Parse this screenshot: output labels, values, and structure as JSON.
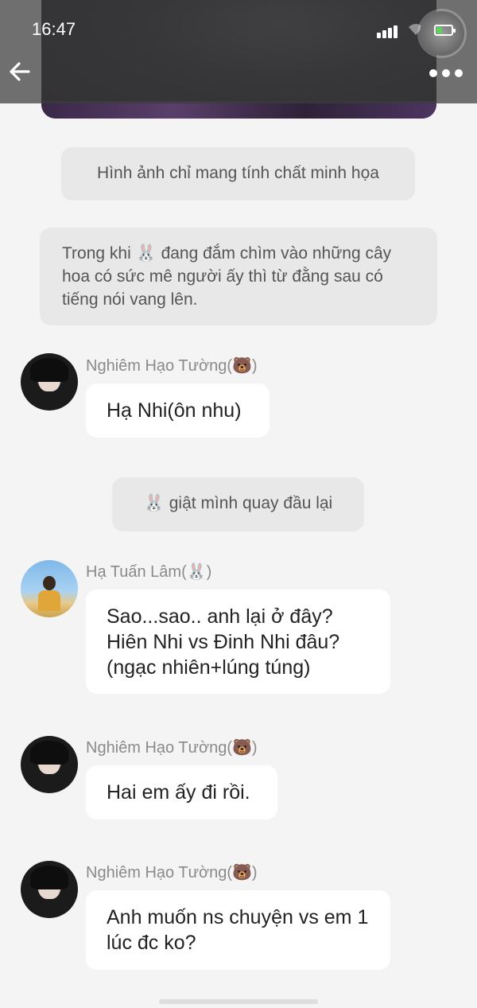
{
  "status_bar": {
    "time": "16:47"
  },
  "narrations": [
    "Hình ảnh chỉ mang tính chất minh họa",
    "Trong khi 🐰 đang đắm chìm vào những cây hoa có sức mê người ấy thì từ đằng sau có tiếng nói vang lên.",
    "🐰 giật mình quay đầu lại"
  ],
  "messages": [
    {
      "speaker": "Nghiêm Hạo Tường(🐻)",
      "text": "Hạ Nhi(ôn nhu)"
    },
    {
      "speaker": "Hạ Tuấn Lâm(🐰)",
      "text": "Sao...sao.. anh lại ở đây? Hiên Nhi vs Đinh Nhi đâu?(ngạc nhiên+lúng túng)"
    },
    {
      "speaker": "Nghiêm Hạo Tường(🐻)",
      "text": "Hai em ấy đi rồi."
    },
    {
      "speaker": "Nghiêm Hạo Tường(🐻)",
      "text": "Anh muốn ns chuyện vs em 1 lúc đc ko?"
    }
  ]
}
